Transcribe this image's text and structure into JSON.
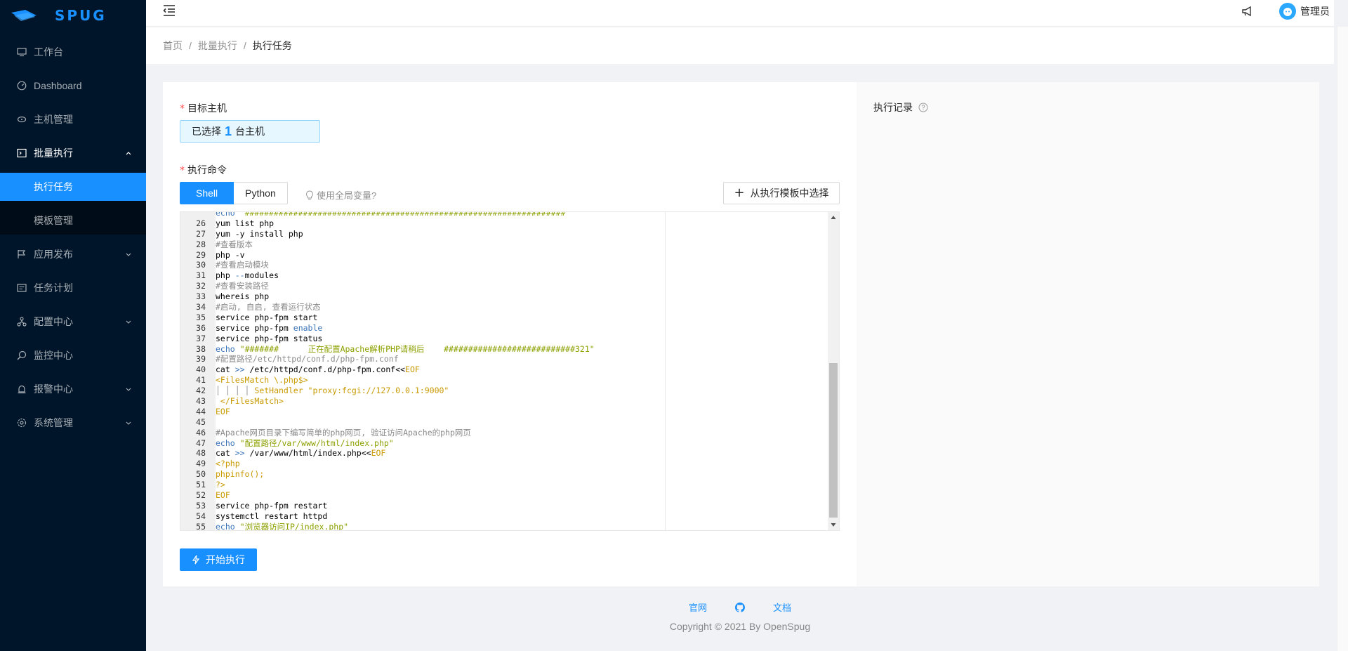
{
  "brand": {
    "name": "SPUG"
  },
  "sidebar": {
    "items": [
      {
        "label": "工作台",
        "icon": "desktop-icon"
      },
      {
        "label": "Dashboard",
        "icon": "dashboard-icon"
      },
      {
        "label": "主机管理",
        "icon": "cloud-server-icon"
      },
      {
        "label": "批量执行",
        "icon": "code-icon",
        "expanded": true
      },
      {
        "label": "应用发布",
        "icon": "flag-icon"
      },
      {
        "label": "任务计划",
        "icon": "schedule-icon"
      },
      {
        "label": "配置中心",
        "icon": "deployment-unit-icon"
      },
      {
        "label": "监控中心",
        "icon": "monitor-icon"
      },
      {
        "label": "报警中心",
        "icon": "alert-icon"
      },
      {
        "label": "系统管理",
        "icon": "setting-icon"
      }
    ],
    "sub_items": [
      {
        "label": "执行任务",
        "active": true
      },
      {
        "label": "模板管理",
        "active": false
      }
    ]
  },
  "header": {
    "username": "管理员"
  },
  "breadcrumb": [
    "首页",
    "批量执行",
    "执行任务"
  ],
  "form": {
    "target_label": "目标主机",
    "host_prefix": "已选择",
    "host_count": "1",
    "host_suffix": "台主机",
    "command_label": "执行命令",
    "tabs": [
      "Shell",
      "Python"
    ],
    "hint": "使用全局变量?",
    "template_button": "从执行模板中选择",
    "run_button": "开始执行"
  },
  "editor": {
    "line_numbers": [
      "26",
      "27",
      "28",
      "29",
      "30",
      "31",
      "32",
      "33",
      "34",
      "35",
      "36",
      "37",
      "38",
      "39",
      "40",
      "41",
      "42",
      "43",
      "44",
      "45",
      "46",
      "47",
      "48",
      "49",
      "50",
      "51",
      "52",
      "53",
      "54",
      "55"
    ]
  },
  "record": {
    "title": "执行记录"
  },
  "footer": {
    "links": [
      "官网",
      "文档"
    ],
    "copyright": "Copyright © 2021 By OpenSpug"
  },
  "colors": {
    "primary": "#1890ff",
    "sider": "#001529"
  }
}
